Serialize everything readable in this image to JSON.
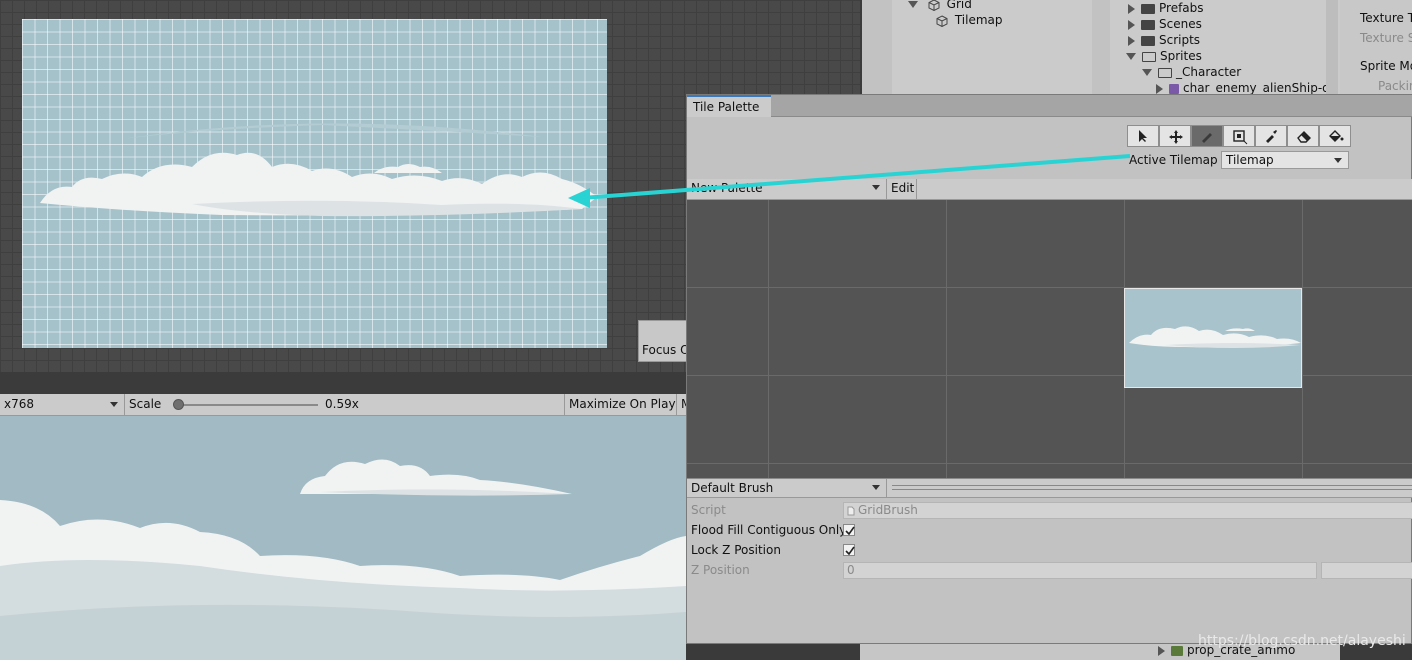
{
  "scene": {
    "focus_label": "Focus O"
  },
  "hierarchy": {
    "items": [
      {
        "label": "Grid"
      },
      {
        "label": "Tilemap"
      }
    ]
  },
  "project": {
    "items": [
      {
        "label": "Prefabs"
      },
      {
        "label": "Scenes"
      },
      {
        "label": "Scripts"
      },
      {
        "label": "Sprites"
      },
      {
        "label": "_Character"
      },
      {
        "label": "char_enemy_alienShip-da"
      },
      {
        "label": "prop_crate_ammo"
      }
    ]
  },
  "inspector": {
    "labels": [
      "Texture T",
      "Texture S",
      "Sprite Mo",
      "Packin"
    ]
  },
  "game_bar": {
    "resolution": "x768",
    "scale_label": "Scale",
    "scale_value": "0.59x",
    "scale_fraction": 0.03,
    "maximize": "Maximize On Play",
    "next": "M"
  },
  "tile_palette": {
    "tab": "Tile Palette",
    "tools": [
      "select-tool-icon",
      "move-tool-icon",
      "paint-tool-icon",
      "box-fill-tool-icon",
      "picker-tool-icon",
      "eraser-tool-icon",
      "fill-tool-icon"
    ],
    "active_tilemap_label": "Active Tilemap",
    "active_tilemap_value": "Tilemap",
    "palette_name": "New Palette",
    "edit_label": "Edit",
    "brush_name": "Default Brush",
    "properties": {
      "script_label": "Script",
      "script_value": "GridBrush",
      "flood_label": "Flood Fill Contiguous Only",
      "flood_checked": true,
      "lock_label": "Lock Z Position",
      "lock_checked": true,
      "zpos_label": "Z Position",
      "zpos_value": "0"
    }
  },
  "colors": {
    "arrow": "#29d3d3",
    "sky": "#a5c2cb",
    "active_tab": "#3a79bd"
  },
  "watermark": "https://blog.csdn.net/alayeshi"
}
